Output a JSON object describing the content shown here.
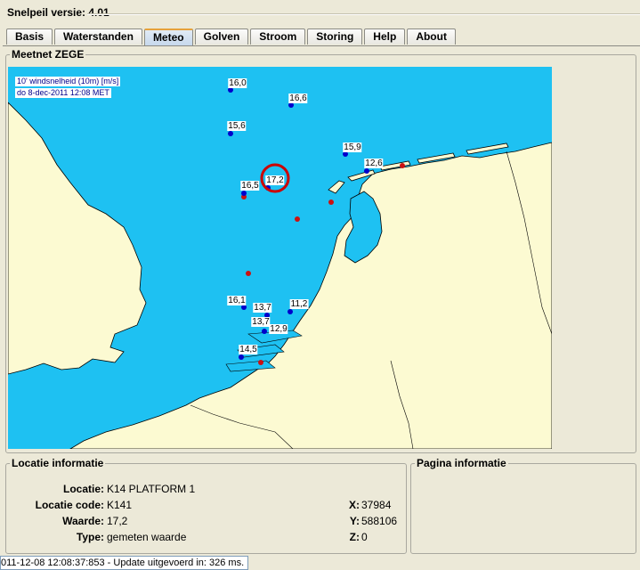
{
  "app": {
    "title": "Snelpeil versie: 4.01"
  },
  "tabs": [
    {
      "label": "Basis"
    },
    {
      "label": "Waterstanden"
    },
    {
      "label": "Meteo"
    },
    {
      "label": "Golven"
    },
    {
      "label": "Stroom"
    },
    {
      "label": "Storing"
    },
    {
      "label": "Help"
    },
    {
      "label": "About"
    }
  ],
  "active_tab": "Meteo",
  "map": {
    "group_label": "Meetnet ZEGE",
    "legend_line1": "10' windsnelheid (10m) [m/s]",
    "legend_line2": "do 8-dec-2011 12:08 MET",
    "colors": {
      "sea": "#1ec1f2",
      "land": "#fcfad2",
      "station_active": "#0000cc",
      "station_inactive": "#cc1111",
      "highlight": "#cc0000"
    },
    "stations": [
      {
        "value": "16,0"
      },
      {
        "value": "16,6"
      },
      {
        "value": "15,6"
      },
      {
        "value": "15,9"
      },
      {
        "value": "12,6"
      },
      {
        "value": "17,2"
      },
      {
        "value": "16,5"
      },
      {
        "value": "16,1"
      },
      {
        "value": "13,7"
      },
      {
        "value": "11,2"
      },
      {
        "value": "13,7"
      },
      {
        "value": "12,9"
      },
      {
        "value": "14,5"
      }
    ]
  },
  "location_info": {
    "group_label": "Locatie informatie",
    "locatie_label": "Locatie:",
    "locatie_value": "K14 PLATFORM 1",
    "code_label": "Locatie code:",
    "code_value": "K141",
    "waarde_label": "Waarde:",
    "waarde_value": "17,2",
    "type_label": "Type:",
    "type_value": "gemeten waarde",
    "x_label": "X:",
    "x_value": "37984",
    "y_label": "Y:",
    "y_value": "588106",
    "z_label": "Z:",
    "z_value": "0"
  },
  "page_info": {
    "group_label": "Pagina informatie"
  },
  "status": {
    "text": "011-12-08 12:08:37:853 - Update uitgevoerd in: 326 ms."
  }
}
